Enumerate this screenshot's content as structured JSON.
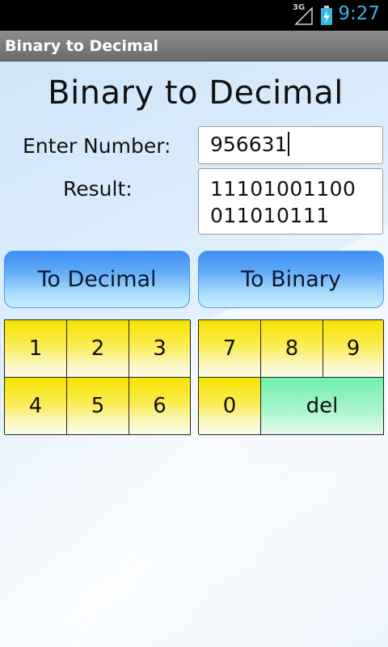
{
  "status_bar": {
    "network": "3G",
    "time": "9:27"
  },
  "title_bar": {
    "title": "Binary to Decimal"
  },
  "main": {
    "heading": "Binary to Decimal",
    "enter_label": "Enter Number:",
    "number_value": "956631",
    "result_label": "Result:",
    "result_value": "11101001100\n011010111"
  },
  "buttons": {
    "to_decimal": "To Decimal",
    "to_binary": "To Binary"
  },
  "keypad_left": [
    "1",
    "2",
    "3",
    "4",
    "5",
    "6"
  ],
  "keypad_right": [
    "7",
    "8",
    "9",
    "0",
    "del"
  ],
  "colors": {
    "time": "#33b5e5",
    "key": "#f7e300",
    "del_key": "#6ff0ab",
    "action_button": "#3f8ff5"
  }
}
